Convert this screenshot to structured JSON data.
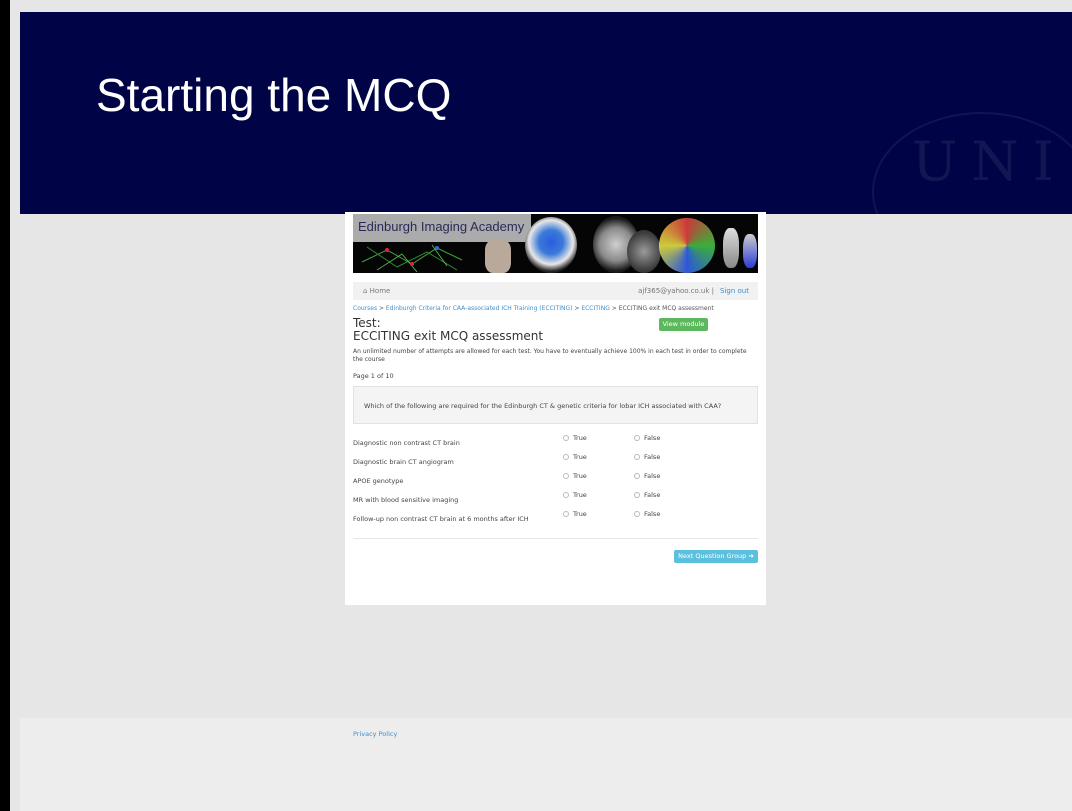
{
  "slide": {
    "title": "Starting the MCQ"
  },
  "banner": {
    "label": "Edinburgh Imaging Academy"
  },
  "navbar": {
    "home": "Home",
    "email": "ajf365@yahoo.co.uk |",
    "signout": "Sign out"
  },
  "breadcrumb": {
    "courses": "Courses",
    "course": "Edinburgh Criteria for CAA-associated ICH Training (ECCITING)",
    "module": "ECCITING",
    "current": "ECCITING exit MCQ assessment",
    "sep": " > "
  },
  "test": {
    "label": "Test:",
    "name": "ECCITING exit MCQ assessment",
    "view_module": "View module"
  },
  "notice": "An unlimited number of attempts are allowed for each test. You have to eventually achieve 100% in each test in order to complete the course",
  "page_indicator": "Page 1 of 10",
  "question": "Which of the following are required for the Edinburgh CT & genetic criteria for lobar ICH associated with CAA?",
  "options": {
    "true_label": "True",
    "false_label": "False"
  },
  "answers": [
    {
      "label": "Diagnostic non contrast CT brain"
    },
    {
      "label": "Diagnostic brain CT angiogram"
    },
    {
      "label": "APOE genotype"
    },
    {
      "label": "MR with blood sensitive imaging"
    },
    {
      "label": "Follow-up non contrast CT brain at 6 months after ICH"
    }
  ],
  "next_button": "Next Question Group",
  "footer": {
    "privacy": "Privacy Policy"
  }
}
